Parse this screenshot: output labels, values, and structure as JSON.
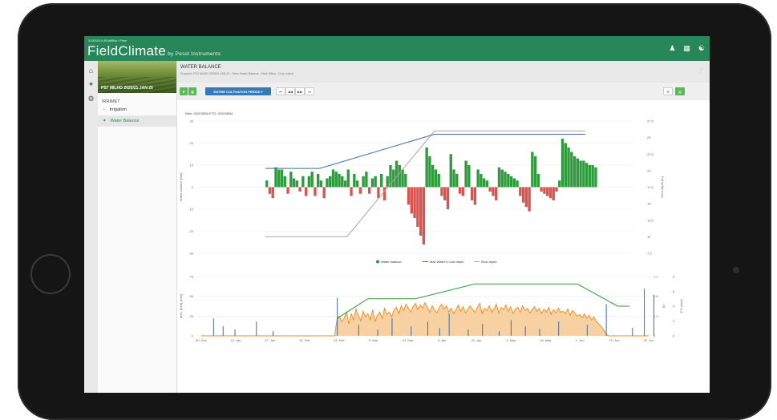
{
  "app": {
    "crumb": "20201014-4f1dd9ba / Plum",
    "logo_main": "FieldClimate",
    "logo_sub": "by Pessl Instruments",
    "top_icons": [
      "user-icon",
      "factory-icon",
      "wifi-icon"
    ]
  },
  "sidebar": {
    "station_label": "PS7 MILHO 2020/21 JAN 20",
    "section": "IRRIMET",
    "items": [
      {
        "label": "Irrigation",
        "icon": "sprinkler-icon"
      },
      {
        "label": "Water Balance",
        "icon": "plant-icon"
      }
    ]
  },
  "header": {
    "title": "WATER BALANCE",
    "subtitle": "Croptone: PS7 MILHO 2020/21 JAN 20 - Farm: Brazil_Balance - Field: Biltey - Crop: maize"
  },
  "toolbar": {
    "btn_close": "✖",
    "btn_calendar": "▦",
    "period_label": "ENTIRE CULTIVATION PERIOD ▾",
    "nav_first": "⏮",
    "nav_prev": "◀◀",
    "nav_next": "▶▶",
    "nav_last": "⏭",
    "view_table": "☰",
    "view_chart": "▤"
  },
  "meta": {
    "text": "Rain: 00203EB4   ETO: 00203EB4"
  },
  "colors": {
    "brand": "#27875a",
    "positive": "#2f9b3c",
    "negative": "#d9534f",
    "max_water": "#3a6ea8",
    "root_depth": "#a8a8a8",
    "area": "#f7c992",
    "area_line": "#f08a1c",
    "rain": "#3a6ea8",
    "secondary_line": "#2f9b3c"
  },
  "chart_data": [
    {
      "type": "bar",
      "ylabel": "Water balance [mm]",
      "y2label": "Root depth [m]",
      "ylim": [
        -30,
        30
      ],
      "y2lim": [
        7.5,
        27.5
      ],
      "yticks": [
        "30",
        "20",
        "10",
        "0",
        "-10",
        "-20",
        "-30"
      ],
      "y2ticks": [
        "27.5",
        "25",
        "22.5",
        "20",
        "17.5",
        "15",
        "12.5",
        "10",
        "7.5"
      ],
      "legend": [
        "Water balance",
        "Max Water in root depth",
        "Root depth"
      ],
      "legend_position": "bottom",
      "grid": true,
      "water_balance": [
        3,
        -3,
        -5,
        9,
        8,
        8,
        5,
        -3,
        7,
        4,
        3,
        -2,
        5,
        -4,
        5,
        7,
        -4,
        6,
        3,
        -5,
        4,
        5,
        8,
        7,
        6,
        5,
        3,
        8,
        -4,
        6,
        3,
        -3,
        5,
        7,
        -3,
        4,
        5,
        -5,
        6,
        -6,
        5,
        10,
        8,
        12,
        10,
        8,
        6,
        -8,
        -12,
        -14,
        -18,
        -22,
        -26,
        18,
        14,
        10,
        8,
        6,
        -4,
        -6,
        -10,
        15,
        8,
        6,
        -3,
        -4,
        12,
        10,
        -6,
        -8,
        8,
        6,
        4,
        3,
        -2,
        -4,
        -6,
        9,
        8,
        7,
        6,
        5,
        4,
        3,
        -4,
        -7,
        -9,
        -11,
        16,
        14,
        6,
        -2,
        -3,
        -4,
        -5,
        -6,
        -2,
        3,
        22,
        20,
        18,
        16,
        14,
        13,
        12,
        12,
        11,
        10,
        10,
        9
      ],
      "max_water_line": [
        [
          0,
          8.5
        ],
        [
          18,
          8.5
        ],
        [
          56,
          24
        ],
        [
          106,
          24
        ]
      ],
      "root_depth_line": [
        [
          0,
          10
        ],
        [
          27,
          10
        ],
        [
          56,
          26
        ],
        [
          106,
          26
        ]
      ]
    },
    {
      "type": "area",
      "ylabel": "prec. [mm], [mm]",
      "y2label": "Kc",
      "y3label": "ETo [mm]",
      "ylim": [
        0,
        75
      ],
      "y2lim": [
        0,
        1.2
      ],
      "y3lim": [
        0,
        8
      ],
      "yticks": [
        "75",
        "50",
        "25",
        "0"
      ],
      "y2ticks": [
        "1.2",
        "0.8",
        "0.4",
        "0"
      ],
      "y3ticks": [
        "8",
        "6",
        "4",
        "2",
        "0"
      ],
      "x_labels": [
        "30. Dec",
        "13. Jan",
        "27. Jan",
        "10. Feb",
        "24. Feb",
        "9. Mar",
        "23. Mar",
        "6. Apr",
        "20. Apr",
        "4. May",
        "18. May",
        "1. Jun",
        "15. Jun",
        "29. Jun"
      ],
      "area_values": [
        0,
        0,
        0,
        0,
        0,
        0,
        0,
        0,
        0,
        0,
        0,
        0,
        0,
        0,
        0,
        0,
        0,
        0,
        0,
        0,
        0,
        0,
        0,
        0,
        0,
        0,
        0,
        0,
        0,
        0,
        0,
        0,
        0,
        0,
        0,
        0,
        0,
        0,
        0,
        0,
        0,
        0,
        0,
        0,
        0,
        0,
        0,
        0,
        0,
        0,
        0,
        0,
        0,
        0,
        0,
        0,
        0,
        20,
        25,
        18,
        22,
        30,
        15,
        28,
        20,
        34,
        26,
        19,
        31,
        24,
        28,
        20,
        33,
        18,
        26,
        30,
        22,
        35,
        27,
        30,
        24,
        33,
        36,
        28,
        38,
        32,
        40,
        35,
        30,
        37,
        41,
        33,
        39,
        35,
        42,
        36,
        30,
        38,
        33,
        29,
        36,
        40,
        34,
        38,
        30,
        35,
        28,
        33,
        39,
        31,
        37,
        29,
        34,
        38,
        33,
        30,
        36,
        41,
        28,
        35,
        32,
        38,
        30,
        34,
        40,
        29,
        36,
        33,
        39,
        31,
        37,
        28,
        34,
        36,
        30,
        38,
        32,
        35,
        29,
        33,
        37,
        31,
        35,
        28,
        34,
        30,
        36,
        27,
        33,
        29,
        35,
        30,
        31,
        28,
        34,
        26,
        32,
        29,
        25,
        27,
        23,
        28,
        22,
        26,
        20,
        24,
        18,
        15,
        12,
        8,
        3,
        0,
        0,
        0,
        0,
        0,
        0,
        0,
        0,
        0,
        0,
        0,
        0,
        0,
        0,
        0,
        0,
        0,
        0
      ],
      "kc_line": [
        [
          57,
          0.35
        ],
        [
          70,
          0.75
        ],
        [
          90,
          0.75
        ],
        [
          115,
          1.05
        ],
        [
          158,
          1.05
        ],
        [
          175,
          0.6
        ],
        [
          180,
          0.6
        ]
      ],
      "rain_bars": [
        [
          5,
          22
        ],
        [
          9,
          12
        ],
        [
          14,
          8
        ],
        [
          23,
          18
        ],
        [
          30,
          6
        ],
        [
          57,
          48
        ],
        [
          66,
          14
        ],
        [
          74,
          8
        ],
        [
          80,
          22
        ],
        [
          88,
          12
        ],
        [
          95,
          18
        ],
        [
          100,
          10
        ],
        [
          104,
          28
        ],
        [
          112,
          8
        ],
        [
          118,
          15
        ],
        [
          125,
          6
        ],
        [
          130,
          20
        ],
        [
          136,
          12
        ],
        [
          142,
          9
        ],
        [
          150,
          18
        ],
        [
          162,
          14
        ],
        [
          170,
          40
        ],
        [
          181,
          10
        ],
        [
          186,
          60
        ],
        [
          190,
          52
        ]
      ]
    }
  ]
}
